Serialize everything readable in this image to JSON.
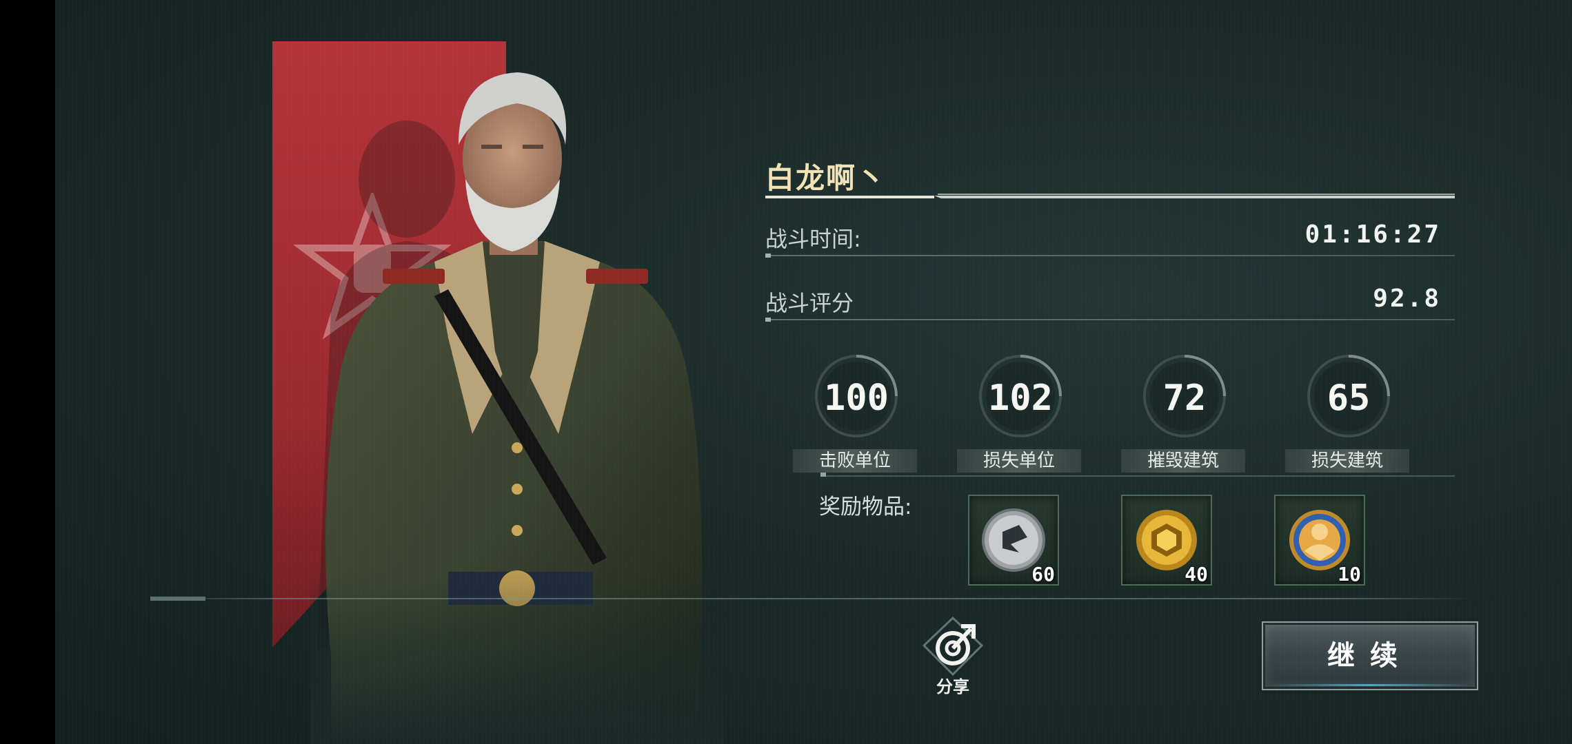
{
  "player": {
    "name": "白龙啊丶"
  },
  "stats": {
    "battle_time_label": "战斗时间:",
    "battle_time_value": "01:16:27",
    "battle_score_label": "战斗评分",
    "battle_score_value": "92.8"
  },
  "circle_stats": [
    {
      "value": "100",
      "label": "击败单位"
    },
    {
      "value": "102",
      "label": "损失单位"
    },
    {
      "value": "72",
      "label": "摧毁建筑"
    },
    {
      "value": "65",
      "label": "损失建筑"
    }
  ],
  "rewards": {
    "label": "奖励物品:",
    "items": [
      {
        "icon": "silver-coin-icon",
        "count": "60"
      },
      {
        "icon": "gold-coin-icon",
        "count": "40"
      },
      {
        "icon": "medal-icon",
        "count": "10"
      }
    ]
  },
  "share": {
    "label": "分享"
  },
  "continue": {
    "label": "继续"
  },
  "colors": {
    "banner_red": "#a8303a",
    "name_gold": "#f2e2b6",
    "panel_bg": "#1a2a29"
  }
}
